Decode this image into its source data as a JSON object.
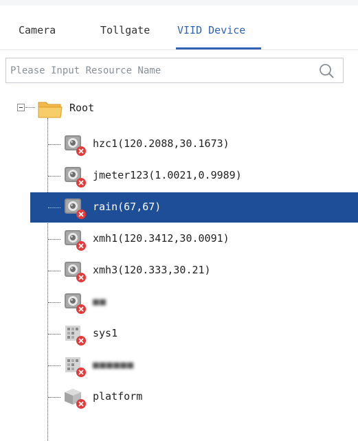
{
  "tabs": [
    {
      "label": "Camera",
      "active": false
    },
    {
      "label": "Tollgate",
      "active": false
    },
    {
      "label": "VIID Device",
      "active": true
    }
  ],
  "accent_color": "#2f62b7",
  "selected_row_color": "#1f4e98",
  "search": {
    "placeholder": "Please Input Resource Name",
    "value": "",
    "icon": "search-icon"
  },
  "tree": {
    "root": {
      "label": "Root",
      "icon": "folder-icon",
      "expanded": true
    },
    "nodes": [
      {
        "label": "hzc1(120.2088,30.1673)",
        "icon": "camera-offline-icon",
        "status": "offline",
        "selected": false
      },
      {
        "label": "jmeter123(1.0021,0.9989)",
        "icon": "camera-offline-icon",
        "status": "offline",
        "selected": false
      },
      {
        "label": "rain(67,67)",
        "icon": "camera-offline-icon",
        "status": "offline",
        "selected": true
      },
      {
        "label": "xmh1(120.3412,30.0091)",
        "icon": "camera-offline-icon",
        "status": "offline",
        "selected": false
      },
      {
        "label": "xmh3(120.333,30.21)",
        "icon": "camera-offline-icon",
        "status": "offline",
        "selected": false
      },
      {
        "label": "",
        "icon": "camera-offline-icon",
        "status": "offline",
        "selected": false,
        "obscured": true
      },
      {
        "label": "sys1",
        "icon": "device-grid-offline-icon",
        "status": "offline",
        "selected": false
      },
      {
        "label": "",
        "icon": "device-grid-offline-icon",
        "status": "offline",
        "selected": false,
        "obscured": true
      },
      {
        "label": "platform",
        "icon": "platform-box-offline-icon",
        "status": "offline",
        "selected": false
      }
    ]
  }
}
